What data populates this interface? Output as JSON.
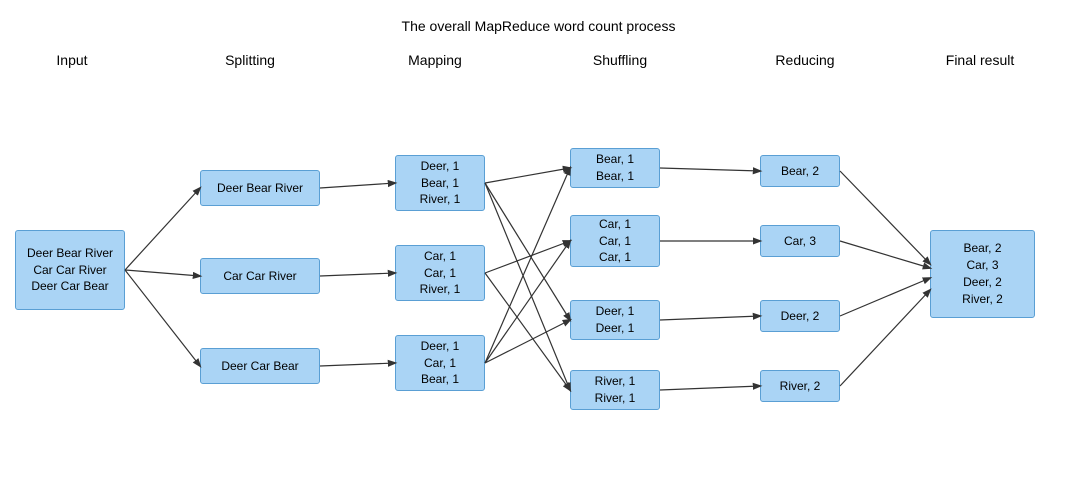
{
  "title": "The overall MapReduce word count process",
  "stages": {
    "input": "Input",
    "splitting": "Splitting",
    "mapping": "Mapping",
    "shuffling": "Shuffling",
    "reducing": "Reducing",
    "final": "Final result"
  },
  "boxes": {
    "input": "Deer Bear River\nCar Car River\nDeer Car Bear",
    "split1": "Deer Bear River",
    "split2": "Car Car River",
    "split3": "Deer Car Bear",
    "map1": "Deer, 1\nBear, 1\nRiver, 1",
    "map2": "Car, 1\nCar, 1\nRiver, 1",
    "map3": "Deer, 1\nCar, 1\nBear, 1",
    "shuf1": "Bear, 1\nBear, 1",
    "shuf2": "Car, 1\nCar, 1\nCar, 1",
    "shuf3": "Deer, 1\nDeer, 1",
    "shuf4": "River, 1\nRiver, 1",
    "red1": "Bear, 2",
    "red2": "Car, 3",
    "red3": "Deer, 2",
    "red4": "River, 2",
    "final": "Bear, 2\nCar, 3\nDeer, 2\nRiver, 2"
  }
}
